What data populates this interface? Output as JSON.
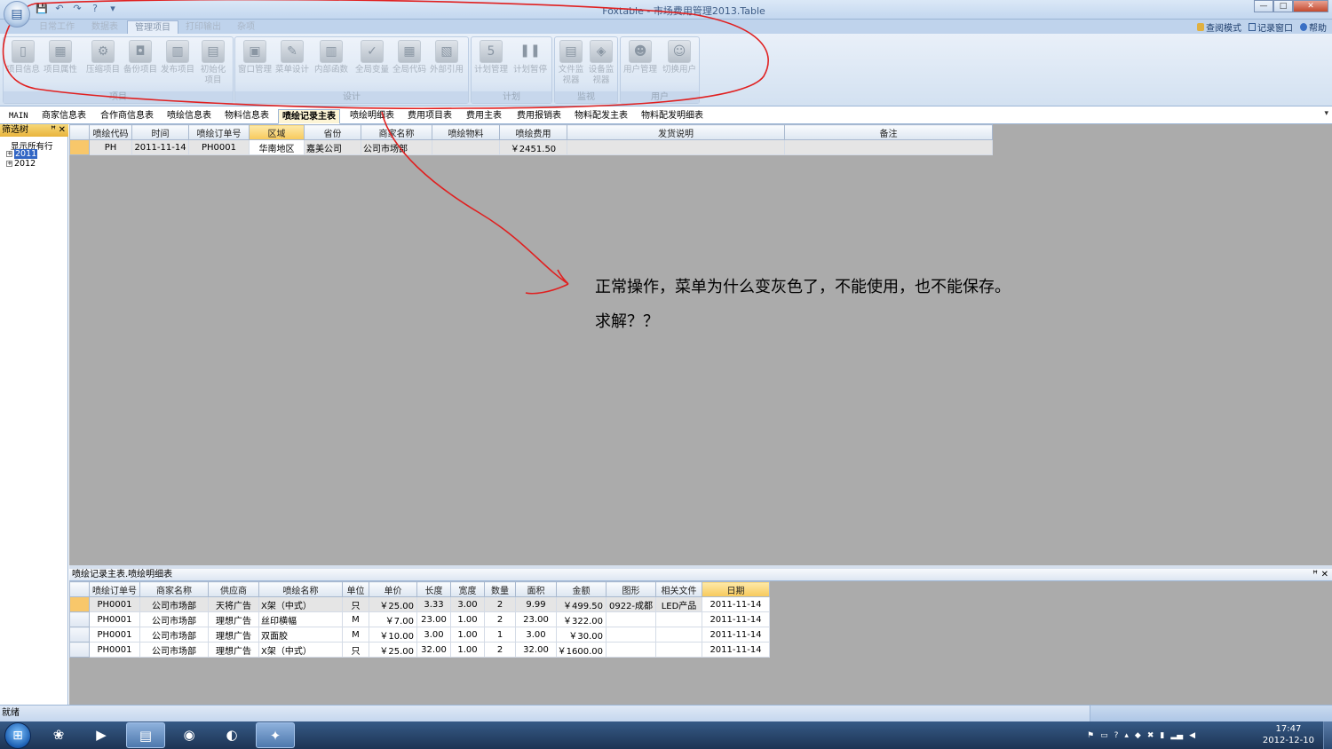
{
  "window": {
    "title": "Foxtable - 市场费用管理2013.Table",
    "buttons": {
      "minimize": "—",
      "maximize": "□",
      "close": "✕"
    }
  },
  "quick_access": {
    "save": "💾",
    "undo": "↶",
    "redo": "↷",
    "help": "?",
    "more": "▾"
  },
  "ribbon": {
    "tabs": [
      "日常工作",
      "数据表",
      "管理项目",
      "打印输出",
      "杂项"
    ],
    "active_tab": "管理项目",
    "groups": [
      {
        "name": "项目",
        "buttons": [
          "项目信息",
          "项目属性",
          "压缩项目",
          "备份项目",
          "发布项目",
          "初始化项目"
        ]
      },
      {
        "name": "设计",
        "buttons": [
          "窗口管理",
          "菜单设计",
          "内部函数",
          "全局变量",
          "全局代码",
          "外部引用"
        ]
      },
      {
        "name": "计划",
        "buttons": [
          "计划管理",
          "计划暂停"
        ]
      },
      {
        "name": "监视",
        "buttons": [
          "文件监视器",
          "设备监视器"
        ]
      },
      {
        "name": "用户",
        "buttons": [
          "用户管理",
          "切换用户"
        ]
      }
    ],
    "right_links": [
      "查阅模式",
      "记录窗口",
      "帮助"
    ]
  },
  "doc_tabs": [
    "MAIN",
    "商家信息表",
    "合作商信息表",
    "喷绘信息表",
    "物料信息表",
    "喷绘记录主表",
    "喷绘明细表",
    "费用项目表",
    "费用主表",
    "费用报销表",
    "物料配发主表",
    "物料配发明细表"
  ],
  "active_doc_tab": "喷绘记录主表",
  "filter_panel": {
    "title": "筛选树",
    "pin": "ꟸ",
    "close": "✕",
    "items": [
      {
        "label": "显示所有行",
        "expander": ""
      },
      {
        "label": "2011",
        "expander": "+",
        "selected": true
      },
      {
        "label": "2012",
        "expander": "+"
      }
    ]
  },
  "main_table": {
    "columns": [
      "喷绘代码",
      "时间",
      "喷绘订单号",
      "区域",
      "省份",
      "商家名称",
      "喷绘物料",
      "喷绘费用",
      "发货说明",
      "备注"
    ],
    "rows": [
      [
        "PH",
        "2011-11-14",
        "PH0001",
        "华南地区",
        "嘉美公司",
        "公司市场部",
        "",
        "￥2451.50",
        "",
        ""
      ]
    ]
  },
  "detail_panel": {
    "title": "喷绘记录主表.喷绘明细表",
    "pin": "ꟸ",
    "close": "✕",
    "columns": [
      "喷绘订单号",
      "商家名称",
      "供应商",
      "喷绘名称",
      "单位",
      "单价",
      "长度",
      "宽度",
      "数量",
      "面积",
      "金额",
      "图形",
      "相关文件",
      "日期"
    ],
    "rows": [
      [
        "PH0001",
        "公司市场部",
        "天将广告",
        "X架（中式）",
        "只",
        "￥25.00",
        "3.33",
        "3.00",
        "2",
        "9.99",
        "￥499.50",
        "0922-成都",
        "LED产品",
        "2011-11-14"
      ],
      [
        "PH0001",
        "公司市场部",
        "理想广告",
        "丝印横幅",
        "M",
        "￥7.00",
        "23.00",
        "1.00",
        "2",
        "23.00",
        "￥322.00",
        "",
        "",
        "2011-11-14"
      ],
      [
        "PH0001",
        "公司市场部",
        "理想广告",
        "双面胶",
        "M",
        "￥10.00",
        "3.00",
        "1.00",
        "1",
        "3.00",
        "￥30.00",
        "",
        "",
        "2011-11-14"
      ],
      [
        "PH0001",
        "公司市场部",
        "理想广告",
        "X架（中式）",
        "只",
        "￥25.00",
        "32.00",
        "1.00",
        "2",
        "32.00",
        "￥1600.00",
        "",
        "",
        "2011-11-14"
      ]
    ]
  },
  "annotation": {
    "line1": "正常操作，菜单为什么变灰色了，不能使用，也不能保存。",
    "line2": "求解？？",
    "ink_color": "#e02020"
  },
  "status": {
    "text": "就绪"
  },
  "taskbar": {
    "start": "⊞",
    "apps": [
      "360",
      "media-player",
      "explorer",
      "browser",
      "messenger",
      "foxtable"
    ],
    "tray": {
      "time": "17:47",
      "date": "2012-12-10"
    }
  },
  "colors": {
    "accent": "#f7c95a",
    "ribbon_bg": "#d3e1f1",
    "grid_bg": "#ababab"
  }
}
